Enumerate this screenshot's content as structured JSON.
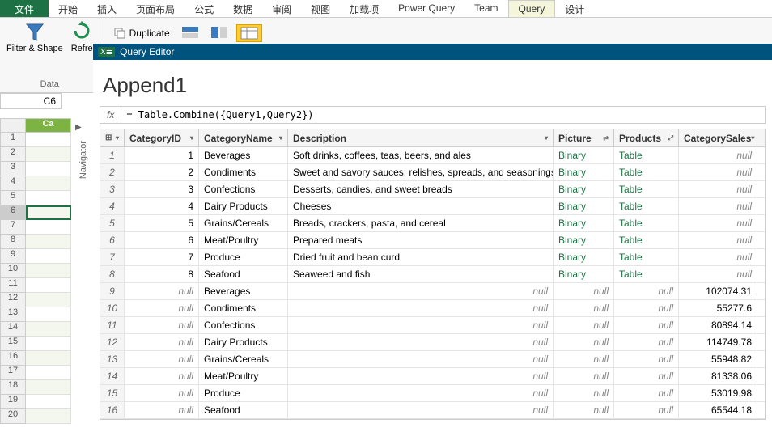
{
  "ribbon": {
    "tabs": [
      "文件",
      "开始",
      "插入",
      "页面布局",
      "公式",
      "数据",
      "审阅",
      "视图",
      "加载项",
      "Power Query",
      "Team",
      "Query",
      "设计"
    ],
    "duplicate": "Duplicate",
    "filter_shape": "Filter & Shape",
    "refresh": "Refre",
    "data_group": "Data"
  },
  "editor_bar": "Query Editor",
  "name_box": "C6",
  "sheet_col": "Ca",
  "navigator": "Navigator",
  "query_name": "Append1",
  "formula": "= Table.Combine({Query1,Query2})",
  "fx": "fx",
  "columns": {
    "id": "CategoryID",
    "name": "CategoryName",
    "desc": "Description",
    "pic": "Picture",
    "prod": "Products",
    "sales": "CategorySales"
  },
  "null_text": "null",
  "link_binary": "Binary",
  "link_table": "Table",
  "rows": [
    {
      "n": 1,
      "id": "1",
      "name": "Beverages",
      "desc": "Soft drinks, coffees, teas, beers, and ales",
      "pic": "Binary",
      "prod": "Table",
      "sales": "null"
    },
    {
      "n": 2,
      "id": "2",
      "name": "Condiments",
      "desc": "Sweet and savory sauces, relishes, spreads, and seasonings",
      "pic": "Binary",
      "prod": "Table",
      "sales": "null"
    },
    {
      "n": 3,
      "id": "3",
      "name": "Confections",
      "desc": "Desserts, candies, and sweet breads",
      "pic": "Binary",
      "prod": "Table",
      "sales": "null"
    },
    {
      "n": 4,
      "id": "4",
      "name": "Dairy Products",
      "desc": "Cheeses",
      "pic": "Binary",
      "prod": "Table",
      "sales": "null"
    },
    {
      "n": 5,
      "id": "5",
      "name": "Grains/Cereals",
      "desc": "Breads, crackers, pasta, and cereal",
      "pic": "Binary",
      "prod": "Table",
      "sales": "null"
    },
    {
      "n": 6,
      "id": "6",
      "name": "Meat/Poultry",
      "desc": "Prepared meats",
      "pic": "Binary",
      "prod": "Table",
      "sales": "null"
    },
    {
      "n": 7,
      "id": "7",
      "name": "Produce",
      "desc": "Dried fruit and bean curd",
      "pic": "Binary",
      "prod": "Table",
      "sales": "null"
    },
    {
      "n": 8,
      "id": "8",
      "name": "Seafood",
      "desc": "Seaweed and fish",
      "pic": "Binary",
      "prod": "Table",
      "sales": "null"
    },
    {
      "n": 9,
      "id": "null",
      "name": "Beverages",
      "desc": "null",
      "pic": "null",
      "prod": "null",
      "sales": "102074.31"
    },
    {
      "n": 10,
      "id": "null",
      "name": "Condiments",
      "desc": "null",
      "pic": "null",
      "prod": "null",
      "sales": "55277.6"
    },
    {
      "n": 11,
      "id": "null",
      "name": "Confections",
      "desc": "null",
      "pic": "null",
      "prod": "null",
      "sales": "80894.14"
    },
    {
      "n": 12,
      "id": "null",
      "name": "Dairy Products",
      "desc": "null",
      "pic": "null",
      "prod": "null",
      "sales": "114749.78"
    },
    {
      "n": 13,
      "id": "null",
      "name": "Grains/Cereals",
      "desc": "null",
      "pic": "null",
      "prod": "null",
      "sales": "55948.82"
    },
    {
      "n": 14,
      "id": "null",
      "name": "Meat/Poultry",
      "desc": "null",
      "pic": "null",
      "prod": "null",
      "sales": "81338.06"
    },
    {
      "n": 15,
      "id": "null",
      "name": "Produce",
      "desc": "null",
      "pic": "null",
      "prod": "null",
      "sales": "53019.98"
    },
    {
      "n": 16,
      "id": "null",
      "name": "Seafood",
      "desc": "null",
      "pic": "null",
      "prod": "null",
      "sales": "65544.18"
    }
  ]
}
